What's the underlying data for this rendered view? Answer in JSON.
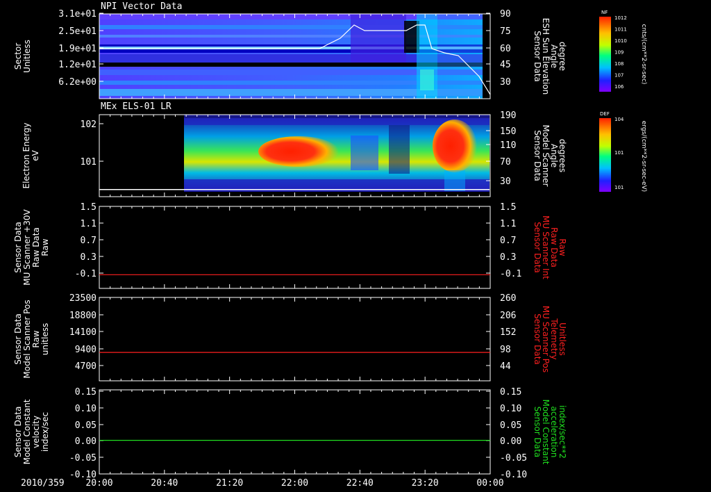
{
  "chart_data": [
    {
      "type": "heatmap",
      "title": "NPI Vector Data",
      "ylabel": "Sector\nUnitless",
      "y_ticks": [
        "3.1e+01",
        "2.5e+01",
        "1.9e+01",
        "1.2e+01",
        "6.2e+00"
      ],
      "y2label": "Sensor Data\nESH Sun Elevation\nAngle\ndegree",
      "y2_ticks": [
        "90",
        "75",
        "60",
        "45",
        "30"
      ],
      "colorbar": {
        "label": "NF",
        "units": "cnts/(cm**2-sr-sec)",
        "ticks": [
          "10^12",
          "10^11",
          "10^10",
          "10^9",
          "10^8",
          "10^7",
          "10^6"
        ]
      }
    },
    {
      "type": "heatmap",
      "title": "MEx ELS-01 LR",
      "ylabel": "Electron Energy\neV",
      "y_ticks": [
        "10^2",
        "10^1"
      ],
      "y2label": "Sensor Data\nModel Scanner\nAngle\ndegrees",
      "y2_ticks": [
        "190",
        "150",
        "110",
        "70",
        "30"
      ],
      "colorbar": {
        "label": "DEF",
        "units": "ergs/(cm**2-sr-sec-eV)",
        "ticks": [
          "10^4",
          "10^1",
          "10^1"
        ]
      }
    },
    {
      "type": "line",
      "ylabel": "Sensor Data\nMU Scanner +30V\nRaw Data\nRaw",
      "y_ticks": [
        "1.5",
        "1.1",
        "0.7",
        "0.3",
        "-0.1"
      ],
      "y2label": "Sensor Data\nMU Scanner Int\nRaw Data\nRaw",
      "y2_ticks": [
        "1.5",
        "1.1",
        "0.7",
        "0.3",
        "-0.1"
      ],
      "series": [
        {
          "values": [
            0.0,
            0.0
          ],
          "color": "#ff2020"
        }
      ],
      "ylim": [
        -0.3,
        1.5
      ]
    },
    {
      "type": "line",
      "ylabel": "Sensor Data\nModel Scanner Pos\nRaw\nunitless",
      "y_ticks": [
        "23500",
        "18800",
        "14100",
        "9400",
        "4700"
      ],
      "y2label": "Sensor Data\nMU Scanner Pos\nTelemetry\nUnitless",
      "y2_ticks": [
        "260",
        "206",
        "152",
        "98",
        "44"
      ],
      "series": [
        {
          "values": [
            8000,
            8000
          ],
          "color": "#ff2020"
        }
      ],
      "ylim": [
        0,
        23500
      ]
    },
    {
      "type": "line",
      "ylabel": "Sensor Data\nModel Constant\nvelocity\nindex/sec",
      "y_ticks": [
        "0.15",
        "0.10",
        "0.05",
        "0.00",
        "-0.05",
        "-0.10"
      ],
      "y2label": "Sensor Data\nModel Constant\nacceleration\nindex/sec**2",
      "y2_ticks": [
        "0.15",
        "0.10",
        "0.05",
        "0.00",
        "-0.05",
        "-0.10"
      ],
      "series": [
        {
          "values": [
            0.0,
            0.0
          ],
          "color": "#20e020"
        }
      ],
      "ylim": [
        -0.1,
        0.15
      ]
    }
  ],
  "x_axis": {
    "date": "2010/359",
    "ticks": [
      "20:00",
      "20:40",
      "21:20",
      "22:00",
      "22:40",
      "23:20",
      "00:00"
    ]
  },
  "colors": {
    "red": "#ff2020",
    "green": "#20e020",
    "axes": "#ffffff"
  }
}
